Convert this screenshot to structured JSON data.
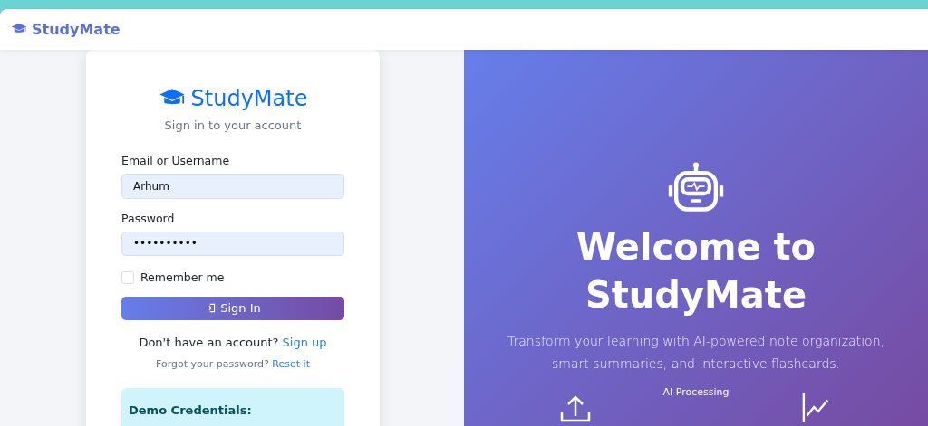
{
  "navbar": {
    "brand": "StudyMate"
  },
  "login": {
    "brand": "StudyMate",
    "subtitle": "Sign in to your account",
    "fields": [
      {
        "label": "Email or Username",
        "value": "Arhum"
      },
      {
        "label": "Password",
        "value": "••••••••••"
      }
    ],
    "remember": {
      "label": "Remember me",
      "checked": false
    },
    "submit": "Sign In",
    "signup": {
      "text": "Don't have an account?",
      "link": "Sign up"
    },
    "reset": {
      "text": "Forgot your password?",
      "link": "Reset it"
    },
    "demo": {
      "title": "Demo Credentials:"
    }
  },
  "hero": {
    "title": "Welcome to StudyMate",
    "text": "Transform your learning with AI-powered note organization, smart summaries, and interactive flashcards.",
    "features": [
      {
        "kind": "upload"
      },
      {
        "kind": "label",
        "label": "AI Processing"
      },
      {
        "kind": "chart"
      }
    ]
  }
}
